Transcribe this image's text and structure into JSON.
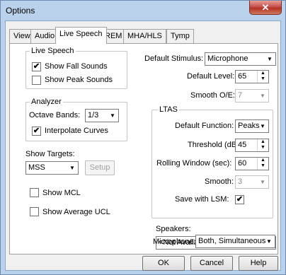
{
  "window": {
    "title": "Options",
    "close_glyph": "✕"
  },
  "tabs": [
    {
      "label": "View"
    },
    {
      "label": "Audio"
    },
    {
      "label": "Live Speech",
      "selected": true
    },
    {
      "label": "REM"
    },
    {
      "label": "MHA/HLS"
    },
    {
      "label": "Tymp"
    }
  ],
  "live_speech": {
    "legend": "Live Speech",
    "show_fall_sounds": {
      "label": "Show Fall Sounds",
      "checked": true
    },
    "show_peak_sounds": {
      "label": "Show Peak Sounds",
      "checked": false
    }
  },
  "analyzer": {
    "legend": "Analyzer",
    "octave_bands_label": "Octave Bands:",
    "octave_bands_value": "1/3",
    "interpolate_curves": {
      "label": "Interpolate Curves",
      "checked": true
    }
  },
  "targets": {
    "label": "Show Targets:",
    "value": "MSS",
    "setup_label": "Setup",
    "show_mcl": {
      "label": "Show MCL",
      "checked": false
    },
    "show_average_ucl": {
      "label": "Show Average UCL",
      "checked": false
    }
  },
  "stimulus": {
    "default_stimulus_label": "Default Stimulus:",
    "default_stimulus_value": "Microphone",
    "default_level_label": "Default Level:",
    "default_level_value": "65",
    "smooth_oe_label": "Smooth O/E:",
    "smooth_oe_value": "7"
  },
  "ltas": {
    "legend": "LTAS",
    "default_function_label": "Default Function:",
    "default_function_value": "Peaks",
    "threshold_label": "Threshold (dB):",
    "threshold_value": "45",
    "rolling_window_label": "Rolling Window (sec):",
    "rolling_window_value": "60",
    "smooth_label": "Smooth:",
    "smooth_value": "3",
    "save_with_lsm": {
      "label": "Save with LSM:",
      "checked": true
    }
  },
  "speakers": {
    "label": "Speakers:",
    "value": "<Not Available>"
  },
  "microphone": {
    "label": "Microphone:",
    "value": "Both, Simultaneous"
  },
  "footer": {
    "ok_label": "OK",
    "cancel_label": "Cancel",
    "help_label": "Help"
  },
  "glyphs": {
    "check": "✔",
    "down": "▼",
    "up": "▲"
  },
  "colors": {
    "title_bar": "#b9d1ea",
    "close_button": "#c75050",
    "panel": "#ffffff",
    "dialog": "#f0f0f0"
  }
}
